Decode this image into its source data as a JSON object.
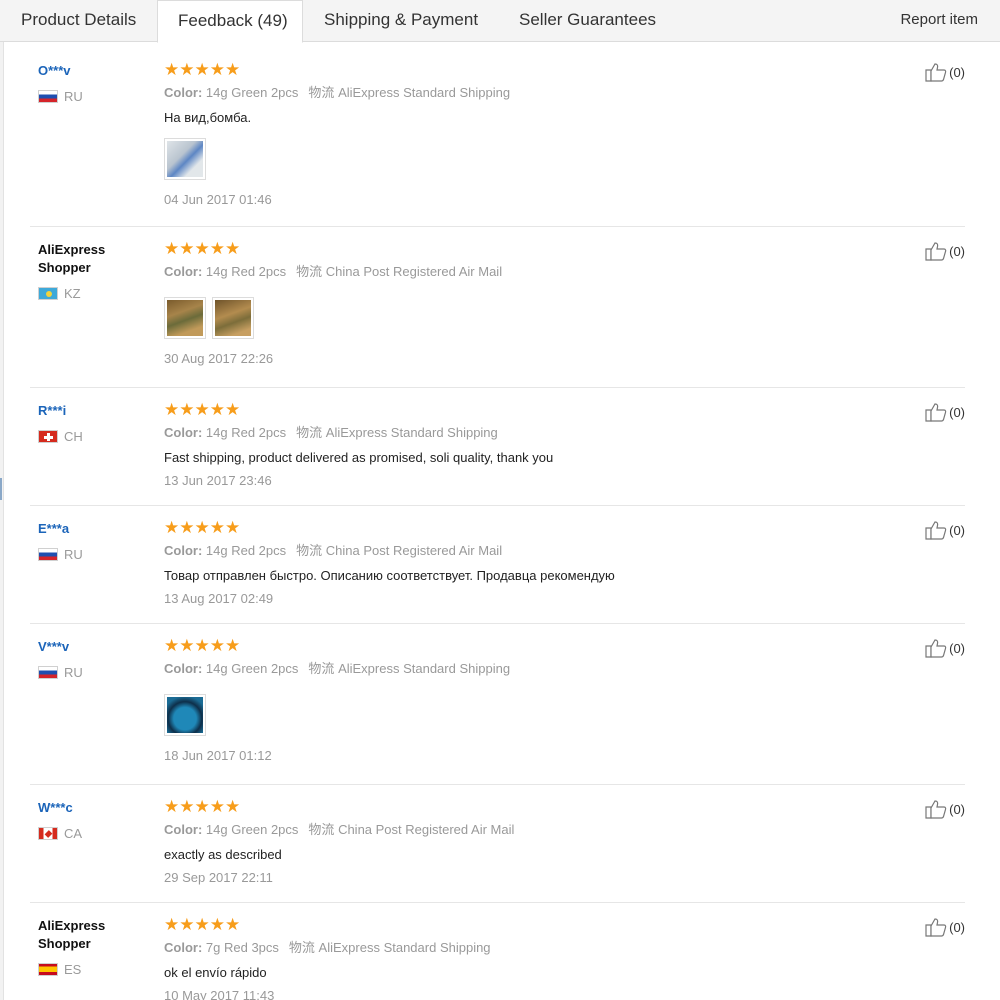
{
  "tabs": [
    {
      "label": "Product Details"
    },
    {
      "label": "Feedback (49)"
    },
    {
      "label": "Shipping & Payment"
    },
    {
      "label": "Seller Guarantees"
    }
  ],
  "report_label": "Report item",
  "color_label": "Color:",
  "shipping_label": "物流",
  "stars_glyph": "★★★★★",
  "reviews": [
    {
      "user": "O***v",
      "country": "RU",
      "flag": "ru",
      "rating": 5,
      "color": "14g Green 2pcs",
      "shipping": "AliExpress Standard Shipping",
      "text": "На вид,бомба.",
      "photos": 1,
      "date": "04 Jun 2017 01:46",
      "helpful": "(0)"
    },
    {
      "user": "AliExpress Shopper",
      "country": "KZ",
      "flag": "kz",
      "rating": 5,
      "color": "14g Red 2pcs",
      "shipping": "China Post Registered Air Mail",
      "text": "",
      "photos": 2,
      "date": "30 Aug 2017 22:26",
      "helpful": "(0)"
    },
    {
      "user": "R***i",
      "country": "CH",
      "flag": "ch",
      "rating": 5,
      "color": "14g Red 2pcs",
      "shipping": "AliExpress Standard Shipping",
      "text": "Fast shipping, product delivered as promised, soli quality, thank you",
      "photos": 0,
      "date": "13 Jun 2017 23:46",
      "helpful": "(0)"
    },
    {
      "user": "E***a",
      "country": "RU",
      "flag": "ru",
      "rating": 5,
      "color": "14g Red 2pcs",
      "shipping": "China Post Registered Air Mail",
      "text": "Товар отправлен быстро. Описанию соответствует. Продавца рекомендую",
      "photos": 0,
      "date": "13 Aug 2017 02:49",
      "helpful": "(0)"
    },
    {
      "user": "V***v",
      "country": "RU",
      "flag": "ru",
      "rating": 5,
      "color": "14g Green 2pcs",
      "shipping": "AliExpress Standard Shipping",
      "text": "",
      "photos": 1,
      "date": "18 Jun 2017 01:12",
      "helpful": "(0)"
    },
    {
      "user": "W***c",
      "country": "CA",
      "flag": "ca",
      "rating": 5,
      "color": "14g Green 2pcs",
      "shipping": "China Post Registered Air Mail",
      "text": "exactly as described",
      "photos": 0,
      "date": "29 Sep 2017 22:11",
      "helpful": "(0)"
    },
    {
      "user": "AliExpress Shopper",
      "country": "ES",
      "flag": "es",
      "rating": 5,
      "color": "7g Red 3pcs",
      "shipping": "AliExpress Standard Shipping",
      "text": "ok el envío rápido",
      "photos": 0,
      "date": "10 May 2017 11:43",
      "helpful": "(0)"
    }
  ]
}
